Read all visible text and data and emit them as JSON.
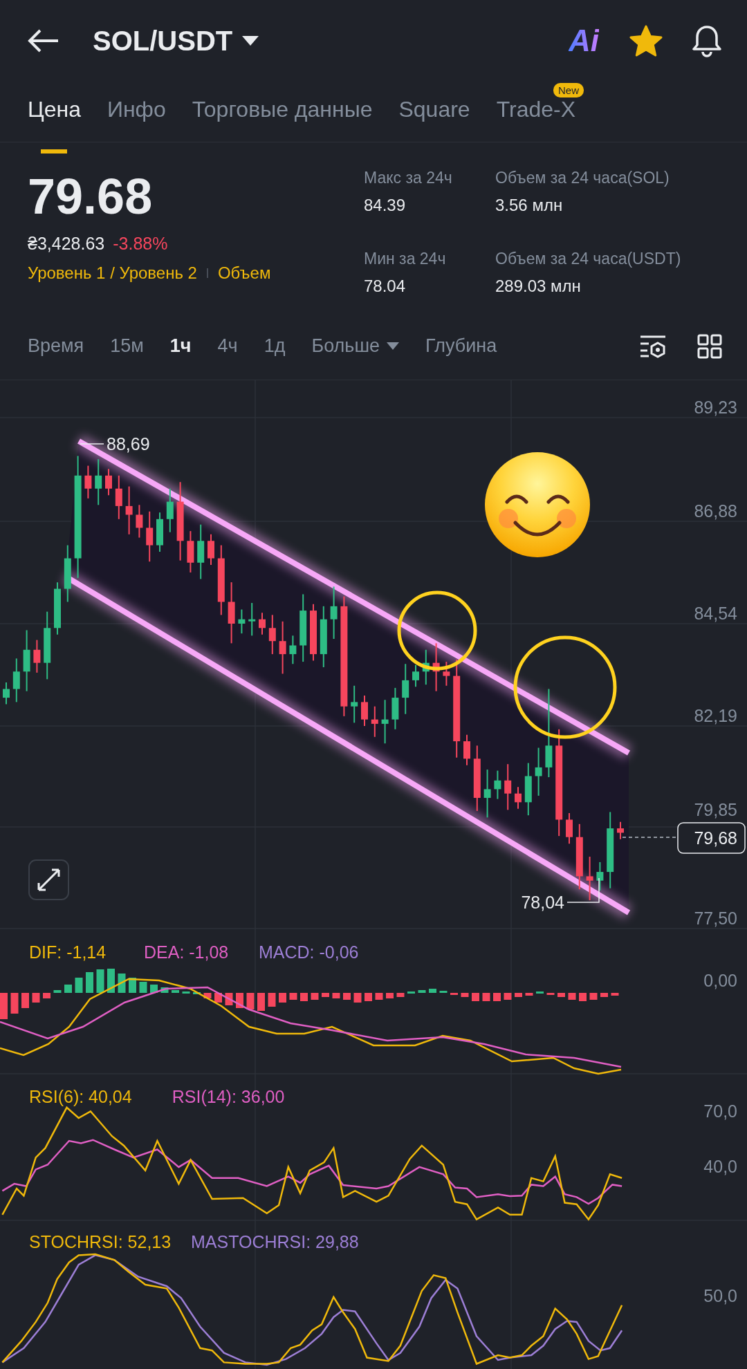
{
  "header": {
    "title": "SOL/USDT",
    "ai_label": "Ai",
    "favorite": true
  },
  "tabs": [
    {
      "label": "Цена",
      "selected": true
    },
    {
      "label": "Инфо",
      "selected": false
    },
    {
      "label": "Торговые данные",
      "selected": false
    },
    {
      "label": "Square",
      "selected": false
    },
    {
      "label": "Trade-X",
      "selected": false,
      "badge": "New"
    }
  ],
  "ticker": {
    "price": "79.68",
    "fiat_price": "₴3,428.63",
    "change": "-3.88%",
    "links": [
      "Уровень 1 / Уровень 2",
      "Объем"
    ],
    "stats": [
      {
        "label": "Макс за 24ч",
        "value": "84.39"
      },
      {
        "label": "Объем за 24 часа(SOL)",
        "value": "3.56 млн"
      },
      {
        "label": "Мин за 24ч",
        "value": "78.04"
      },
      {
        "label": "Объем за 24 часа(USDT)",
        "value": "289.03 млн"
      }
    ]
  },
  "intervals": [
    {
      "label": "Время",
      "selected": false,
      "kind": "plain"
    },
    {
      "label": "15м",
      "selected": false,
      "kind": "plain"
    },
    {
      "label": "1ч",
      "selected": true,
      "kind": "plain"
    },
    {
      "label": "4ч",
      "selected": false,
      "kind": "plain"
    },
    {
      "label": "1д",
      "selected": false,
      "kind": "plain"
    },
    {
      "label": "Больше",
      "selected": false,
      "kind": "dropdown"
    },
    {
      "label": "Глубина",
      "selected": false,
      "kind": "plain"
    }
  ],
  "chart": {
    "price_axis": [
      "89,23",
      "86,88",
      "84,54",
      "82,19",
      "79,85",
      "77,50"
    ],
    "high_label": "88,69",
    "low_label": "78,04",
    "last_price": "79,68"
  },
  "macd": {
    "legend": [
      {
        "text": "DIF: -1,14",
        "color": "#f0b90b"
      },
      {
        "text": "DEA: -1,08",
        "color": "#e05fc4"
      },
      {
        "text": "MACD: -0,06",
        "color": "#9d7fd6"
      }
    ],
    "axis": [
      "0,00"
    ]
  },
  "rsi": {
    "legend": [
      {
        "text": "RSI(6): 40,04",
        "color": "#f0b90b"
      },
      {
        "text": "RSI(14): 36,00",
        "color": "#e05fc4"
      }
    ],
    "axis": [
      "70,0",
      "40,0"
    ]
  },
  "stochrsi": {
    "legend": [
      {
        "text": "STOCHRSI: 52,13",
        "color": "#f0b90b"
      },
      {
        "text": "MASTOCHRSI: 29,88",
        "color": "#9d7fd6"
      }
    ],
    "axis": [
      "50,0"
    ]
  }
}
